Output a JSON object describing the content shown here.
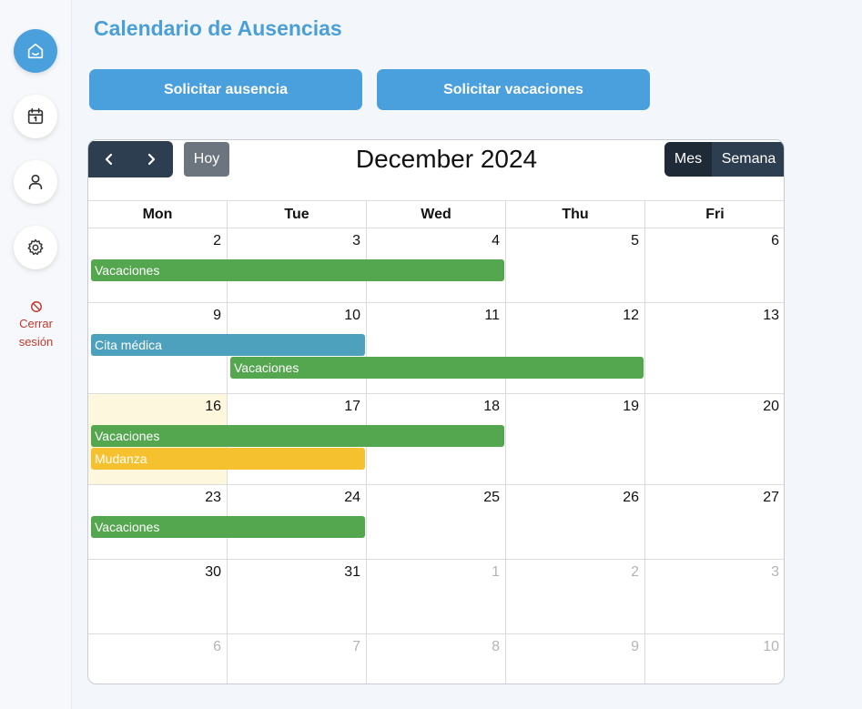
{
  "page": {
    "title": "Calendario de Ausencias"
  },
  "sidebar": {
    "items": [
      {
        "name": "home",
        "icon": "home-icon",
        "active": true
      },
      {
        "name": "calendar",
        "icon": "calendar-icon",
        "active": false
      },
      {
        "name": "profile",
        "icon": "user-icon",
        "active": false
      },
      {
        "name": "settings",
        "icon": "gear-icon",
        "active": false
      }
    ],
    "logout": {
      "icon": "ban-icon",
      "line1": "Cerrar",
      "line2": "sesión",
      "color": "#c0392b"
    }
  },
  "actions": {
    "request_absence": "Solicitar ausencia",
    "request_vacation": "Solicitar vacaciones"
  },
  "calendar": {
    "title": "December 2024",
    "today_label": "Hoy",
    "views": {
      "month": "Mes",
      "week": "Semana"
    },
    "weekdays": [
      "Mon",
      "Tue",
      "Wed",
      "Thu",
      "Fri"
    ],
    "weeks": [
      {
        "days": [
          {
            "n": "2"
          },
          {
            "n": "3"
          },
          {
            "n": "4"
          },
          {
            "n": "5"
          },
          {
            "n": "6"
          }
        ],
        "events": [
          {
            "label": "Vacaciones",
            "start": 0,
            "span": 3,
            "lane": 0,
            "color": "#54a64f"
          }
        ]
      },
      {
        "days": [
          {
            "n": "9"
          },
          {
            "n": "10"
          },
          {
            "n": "11"
          },
          {
            "n": "12"
          },
          {
            "n": "13"
          }
        ],
        "events": [
          {
            "label": "Cita médica",
            "start": 0,
            "span": 2,
            "lane": 0,
            "color": "#4ea1bd"
          },
          {
            "label": "Vacaciones",
            "start": 1,
            "span": 3,
            "lane": 1,
            "color": "#54a64f"
          }
        ]
      },
      {
        "days": [
          {
            "n": "16",
            "today": true
          },
          {
            "n": "17"
          },
          {
            "n": "18"
          },
          {
            "n": "19"
          },
          {
            "n": "20"
          }
        ],
        "events": [
          {
            "label": "Vacaciones",
            "start": 0,
            "span": 3,
            "lane": 0,
            "color": "#54a64f"
          },
          {
            "label": "Mudanza",
            "start": 0,
            "span": 2,
            "lane": 1,
            "color": "#f5c12e"
          }
        ]
      },
      {
        "days": [
          {
            "n": "23"
          },
          {
            "n": "24"
          },
          {
            "n": "25"
          },
          {
            "n": "26"
          },
          {
            "n": "27"
          }
        ],
        "events": [
          {
            "label": "Vacaciones",
            "start": 0,
            "span": 2,
            "lane": 0,
            "color": "#54a64f"
          }
        ]
      },
      {
        "days": [
          {
            "n": "30"
          },
          {
            "n": "31"
          },
          {
            "n": "1",
            "other": true
          },
          {
            "n": "2",
            "other": true
          },
          {
            "n": "3",
            "other": true
          }
        ],
        "events": []
      },
      {
        "days": [
          {
            "n": "6",
            "other": true
          },
          {
            "n": "7",
            "other": true
          },
          {
            "n": "8",
            "other": true
          },
          {
            "n": "9",
            "other": true
          },
          {
            "n": "10",
            "other": true
          }
        ],
        "events": []
      }
    ]
  }
}
